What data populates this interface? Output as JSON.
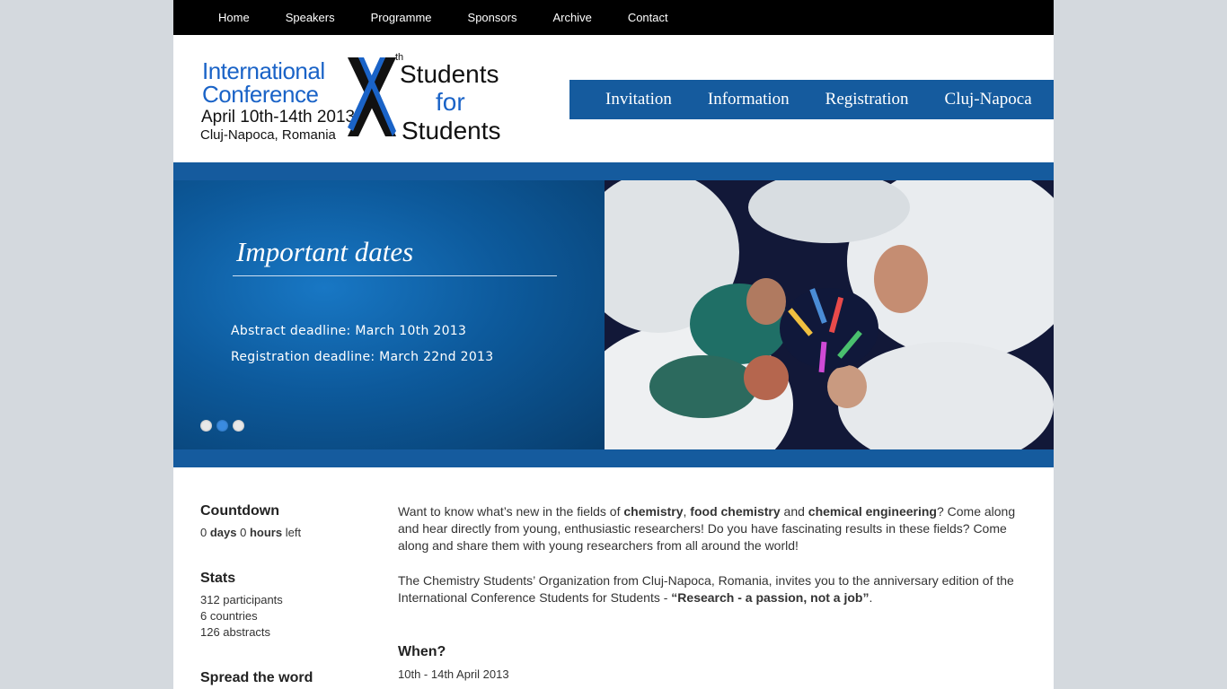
{
  "top_nav": [
    "Home",
    "Speakers",
    "Programme",
    "Sponsors",
    "Archive",
    "Contact"
  ],
  "logo": {
    "line1": "International",
    "line2": "Conference",
    "line3": "April 10th-14th 2013",
    "line4": "Cluj-Napoca, Romania",
    "right1": "Students",
    "right2": "for",
    "right3": "Students",
    "sup": "th"
  },
  "main_nav": [
    "Invitation",
    "Information",
    "Registration",
    "Cluj-Napoca"
  ],
  "slide": {
    "title": "Important dates",
    "line1": "Abstract deadline: March 10th 2013",
    "line2": "Registration deadline: March 22nd 2013",
    "active_dot": 2
  },
  "sidebar": {
    "countdown": {
      "title": "Countdown",
      "days": "0",
      "days_label": "days",
      "hours": "0",
      "hours_label": "hours",
      "left": "left"
    },
    "stats": {
      "title": "Stats",
      "participants": "312 participants",
      "countries": "6 countries",
      "abstracts": "126 abstracts"
    },
    "spread": {
      "title": "Spread the word"
    }
  },
  "main": {
    "p1_a": "Want to know what’s new in the fields of ",
    "p1_b1": "chemistry",
    "p1_c": ", ",
    "p1_b2": "food chemistry",
    "p1_d": " and ",
    "p1_b3": "chemical engineering",
    "p1_e": "? Come along and hear directly from young, enthusiastic researchers! Do you have fascinating results in these fields? Come along and share them with young researchers from all around the world!",
    "p2_a": "The Chemistry Students’ Organization from Cluj-Napoca, Romania, invites you to the anniversary edition of the International Conference Students for Students - ",
    "p2_b": "“Research - a passion, not a job”",
    "p2_c": ".",
    "when_title": "When?",
    "when_text": "10th - 14th April 2013"
  },
  "colors": {
    "accent": "#155b9e",
    "logo_blue": "#1a63c7",
    "topbar": "#000000",
    "background": "#d4d9de"
  }
}
